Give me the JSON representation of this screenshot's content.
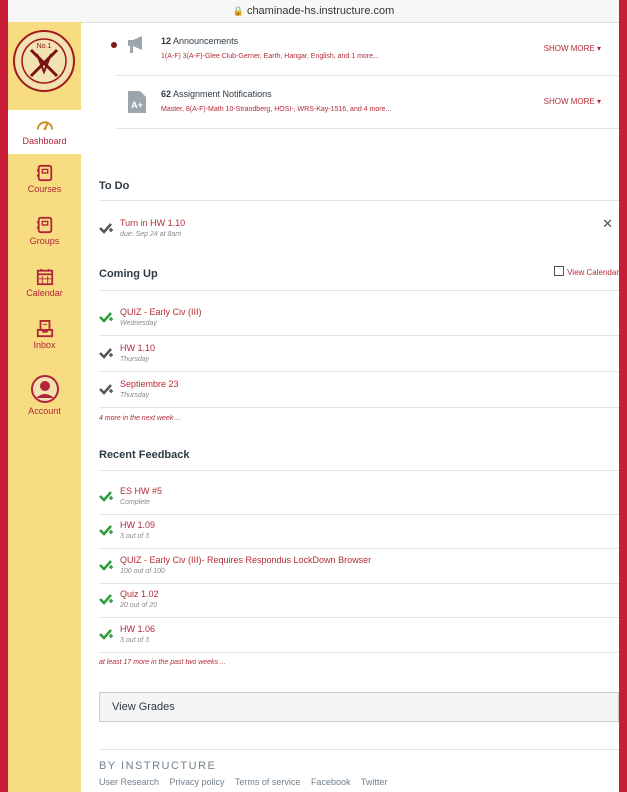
{
  "browser": {
    "url": "chaminade-hs.instructure.com"
  },
  "sidebar": {
    "logo_text": "No.1",
    "items": [
      {
        "label": "Dashboard",
        "icon": "dashboard-icon"
      },
      {
        "label": "Courses",
        "icon": "courses-icon"
      },
      {
        "label": "Groups",
        "icon": "groups-icon"
      },
      {
        "label": "Calendar",
        "icon": "calendar-icon"
      },
      {
        "label": "Inbox",
        "icon": "inbox-icon"
      },
      {
        "label": "Account",
        "icon": "account-icon"
      }
    ]
  },
  "notifications": [
    {
      "count": "12",
      "title": "Announcements",
      "detail": "1(A-F) 3(A-F)-Glee Club-Gerner, Earth, Hangar, English, and 1 more...",
      "action": "SHOW MORE",
      "unread": true
    },
    {
      "count": "62",
      "title": "Assignment Notifications",
      "detail": "Master, 8(A-F)-Math 10-Strandberg, HOSI-, WRS-Kay-1516, and 4 more...",
      "action": "SHOW MORE",
      "unread": false
    }
  ],
  "todo": {
    "heading": "To Do",
    "items": [
      {
        "title": "Turn in HW 1.10",
        "sub": "due: Sep 24 at 8am"
      }
    ]
  },
  "coming_up": {
    "heading": "Coming Up",
    "view_calendar": "View Calendar",
    "items": [
      {
        "title": "QUIZ - Early Civ (III)",
        "sub": "Wednesday",
        "done": true
      },
      {
        "title": "HW 1.10",
        "sub": "Thursday",
        "done": false
      },
      {
        "title": "Septiembre 23",
        "sub": "Thursday",
        "done": false
      }
    ],
    "more": "4 more in the next week ..."
  },
  "feedback": {
    "heading": "Recent Feedback",
    "items": [
      {
        "title": "ES HW #5",
        "sub": "Complete"
      },
      {
        "title": "HW 1.09",
        "sub": "3 out of 3"
      },
      {
        "title": "QUIZ - Early Civ (III)- Requires Respondus LockDown Browser",
        "sub": "100 out of 100"
      },
      {
        "title": "Quiz 1.02",
        "sub": "20 out of 20"
      },
      {
        "title": "HW 1.06",
        "sub": "3 out of 3"
      }
    ],
    "more": "at least 17 more in the past two weeks ..."
  },
  "view_grades": "View Grades",
  "footer": {
    "brand": "BY INSTRUCTURE",
    "links": [
      "User Research",
      "Privacy policy",
      "Terms of service",
      "Facebook",
      "Twitter"
    ]
  },
  "colors": {
    "accent": "#b32b38",
    "sidebar": "#f8dc82",
    "frame": "#c81e35",
    "check_green": "#2a9d3c"
  }
}
